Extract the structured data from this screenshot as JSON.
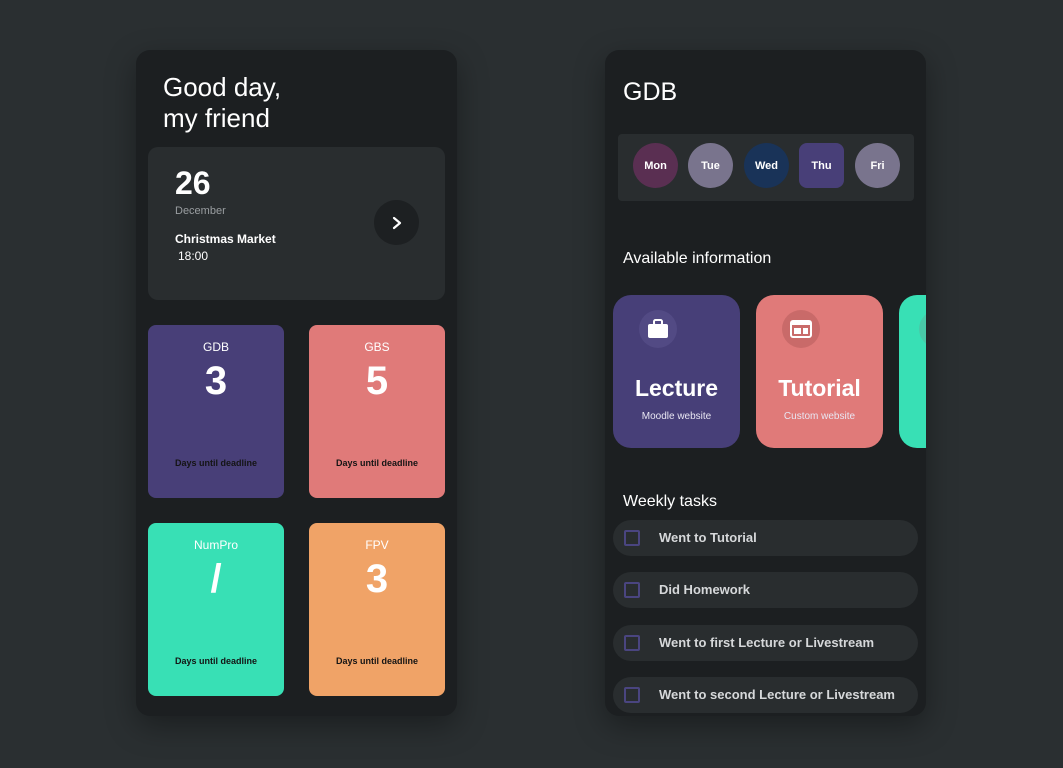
{
  "home": {
    "greeting_line1": "Good day,",
    "greeting_line2": "my friend",
    "event": {
      "day": "26",
      "month": "December",
      "title": "Christmas Market",
      "time": "18:00"
    },
    "deadlines": [
      {
        "course": "GDB",
        "days": "3",
        "caption": "Days until deadline",
        "color": "#483f78"
      },
      {
        "course": "GBS",
        "days": "5",
        "caption": "Days until deadline",
        "color": "#e07a79"
      },
      {
        "course": "NumPro",
        "days": "/",
        "caption": "Days until deadline",
        "color": "#38e0b5"
      },
      {
        "course": "FPV",
        "days": "3",
        "caption": "Days until deadline",
        "color": "#f0a367"
      }
    ]
  },
  "course": {
    "title": "GDB",
    "days": [
      {
        "label": "Mon",
        "color": "#5a2f52"
      },
      {
        "label": "Tue",
        "color": "#79748d"
      },
      {
        "label": "Wed",
        "color": "#193358"
      },
      {
        "label": "Thu",
        "color": "#483f78"
      },
      {
        "label": "Fri",
        "color": "#79748d"
      }
    ],
    "info_heading": "Available information",
    "info_cards": [
      {
        "title": "Lecture",
        "subtitle": "Moodle website",
        "icon": "briefcase-icon"
      },
      {
        "title": "Tutorial",
        "subtitle": "Custom website",
        "icon": "web-window-icon"
      }
    ],
    "tasks_heading": "Weekly tasks",
    "tasks": [
      {
        "label": "Went to Tutorial",
        "done": false
      },
      {
        "label": "Did Homework",
        "done": false
      },
      {
        "label": "Went to first Lecture or Livestream",
        "done": false
      },
      {
        "label": "Went to second Lecture or Livestream",
        "done": false
      }
    ]
  },
  "colors": {
    "background": "#2a2f31",
    "phone": "#1c1f21",
    "card": "#292d2f",
    "accent_purple": "#483f78",
    "accent_red": "#e07a79",
    "accent_green": "#38e0b5",
    "accent_orange": "#f0a367"
  }
}
